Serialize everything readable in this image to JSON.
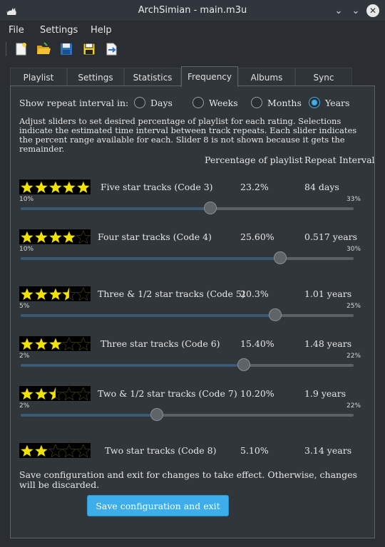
{
  "window": {
    "title": "ArchSimian - main.m3u"
  },
  "menu": [
    "File",
    "Settings",
    "Help"
  ],
  "toolbar": [
    "new-file-icon",
    "open-folder-icon",
    "save-icon",
    "save-as-icon",
    "export-icon"
  ],
  "tabs": [
    {
      "label": "Playlist"
    },
    {
      "label": "Settings"
    },
    {
      "label": "Statistics"
    },
    {
      "label": "Frequency",
      "active": true
    },
    {
      "label": "Albums"
    },
    {
      "label": "Sync"
    }
  ],
  "frequency": {
    "interval_label": "Show repeat interval in:",
    "interval_options": [
      "Days",
      "Weeks",
      "Months",
      "Years"
    ],
    "interval_selected": "Years",
    "instructions": "Adjust sliders to set desired percentage of playlist for each rating.  Selections indicate the estimated time interval between track repeats. Each slider indicates the percent range available for each. Slider 8 is not shown because it gets the remainder.",
    "col_percentage": "Percentage of playlist",
    "col_interval": "Repeat Interval",
    "ratings": [
      {
        "label": "Five star tracks (Code 3)",
        "stars": 5,
        "percent": "23.2%",
        "interval": "84 days",
        "min": "10%",
        "max": "33%",
        "slider_value": 0.57
      },
      {
        "label": "Four star tracks (Code 4)",
        "stars": 4,
        "percent": "25.60%",
        "interval": "0.517 years",
        "min": "10%",
        "max": "30%",
        "slider_value": 0.78
      },
      {
        "label": "Three & 1/2 star tracks (Code 5)",
        "stars": 3.5,
        "percent": "20.3%",
        "interval": "1.01 years",
        "min": "5%",
        "max": "25%",
        "slider_value": 0.765
      },
      {
        "label": "Three star tracks (Code 6)",
        "stars": 3,
        "percent": "15.40%",
        "interval": "1.48 years",
        "min": "2%",
        "max": "22%",
        "slider_value": 0.67
      },
      {
        "label": "Two & 1/2 star tracks (Code 7)",
        "stars": 2.5,
        "percent": "10.20%",
        "interval": "1.9 years",
        "min": "2%",
        "max": "22%",
        "slider_value": 0.41
      },
      {
        "label": "Two star tracks (Code 8)",
        "stars": 2,
        "percent": "5.10%",
        "interval": "3.14 years"
      }
    ],
    "footer": "Save configuration and exit for changes to take effect. Otherwise, changes will be discarded.",
    "save_button": "Save configuration and exit"
  },
  "colors": {
    "accent": "#3daee9",
    "star": "#f2e200",
    "background": "#31363b"
  }
}
